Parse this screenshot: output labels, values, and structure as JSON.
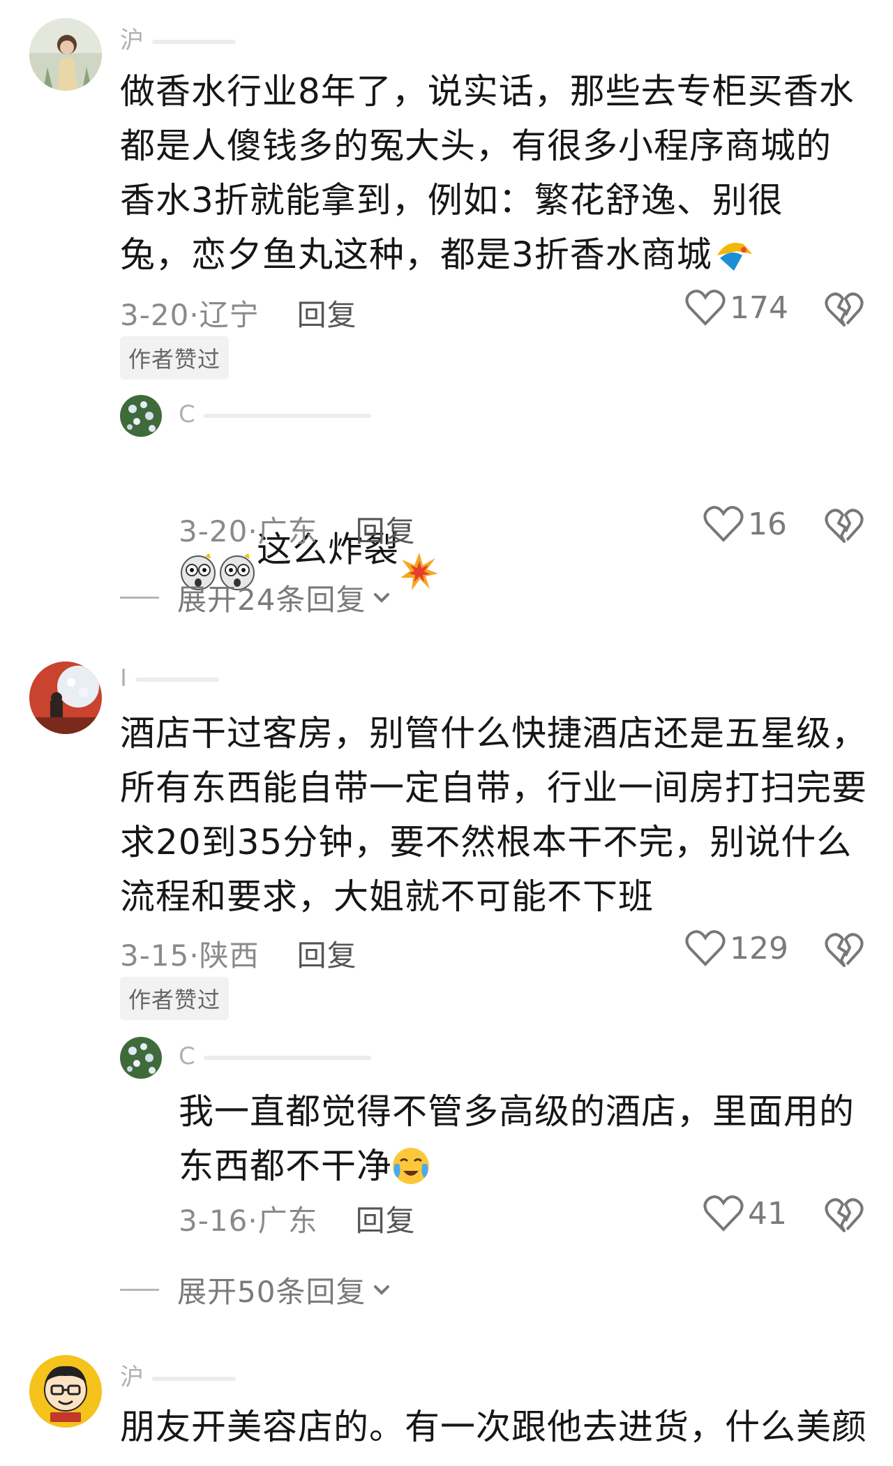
{
  "comments": [
    {
      "username": "沪",
      "text": "做香水行业8年了，说实话，那些去专柜买香水\n都是人傻钱多的冤大头，有很多小程序商城的\n香水3折就能拿到，例如：繁花舒逸、别很\n兔，恋夕鱼丸这种，都是3折香水商城",
      "date_location": "3-20·辽宁",
      "reply_label": "回复",
      "likes": "174",
      "badge": "作者赞过",
      "reply": {
        "username": "C",
        "text": "这么炸裂",
        "date_location": "3-20·广东",
        "reply_label": "回复",
        "likes": "16"
      },
      "expand_label": "展开24条回复"
    },
    {
      "username": "I",
      "text": "酒店干过客房，别管什么快捷酒店还是五星级，\n所有东西能自带一定自带，行业一间房打扫完要\n求20到35分钟，要不然根本干不完，别说什么\n流程和要求，大姐就不可能不下班",
      "date_location": "3-15·陕西",
      "reply_label": "回复",
      "likes": "129",
      "badge": "作者赞过",
      "reply": {
        "username": "C",
        "text": "我一直都觉得不管多高级的酒店，里面用的\n东西都不干净",
        "date_location": "3-16·广东",
        "reply_label": "回复",
        "likes": "41"
      },
      "expand_label": "展开50条回复"
    },
    {
      "username": "沪",
      "text": "朋友开美容店的。有一次跟他去进货，什么美颜"
    }
  ],
  "icons": {
    "like": "heart-icon",
    "dislike": "broken-heart-icon",
    "expand": "chevron-down-icon"
  },
  "colors": {
    "text": "#161616",
    "meta": "#8a8a8a",
    "badge_bg": "#f2f2f2"
  }
}
